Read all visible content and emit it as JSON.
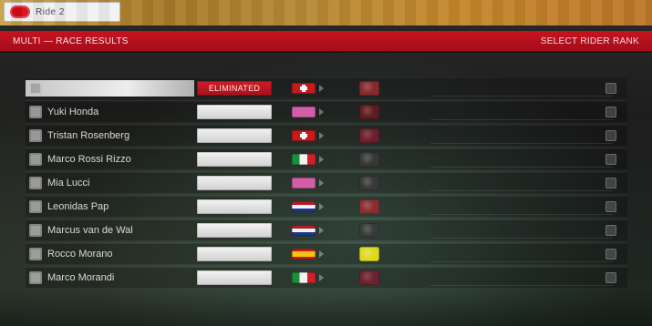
{
  "header": {
    "brand_text": "Ride 2",
    "title_left": "MULTI — RACE RESULTS",
    "title_right": "SELECT RIDER RANK"
  },
  "table": {
    "rows": [
      {
        "name": "",
        "status": "ELIMINATED",
        "flag": "ch",
        "bike_variant": "v2",
        "team": "",
        "selected": true
      },
      {
        "name": "Yuki Honda",
        "status": "",
        "flag": "generic",
        "bike_variant": "v1",
        "team": "",
        "selected": false
      },
      {
        "name": "Tristan Rosenberg",
        "status": "",
        "flag": "ch",
        "bike_variant": "v5",
        "team": "",
        "selected": false
      },
      {
        "name": "Marco Rossi Rizzo",
        "status": "",
        "flag": "it",
        "bike_variant": "v3",
        "team": "",
        "selected": false
      },
      {
        "name": "Mia Lucci",
        "status": "",
        "flag": "generic",
        "bike_variant": "v3",
        "team": "",
        "selected": false
      },
      {
        "name": "Leonidas Pap",
        "status": "",
        "flag": "nl",
        "bike_variant": "v2",
        "team": "",
        "selected": false
      },
      {
        "name": "Marcus van de Wal",
        "status": "",
        "flag": "nl",
        "bike_variant": "v3",
        "team": "",
        "selected": false
      },
      {
        "name": "Rocco Morano",
        "status": "",
        "flag": "es",
        "bike_variant": "v4",
        "team": "",
        "selected": false
      },
      {
        "name": "Marco Morandi",
        "status": "",
        "flag": "it",
        "bike_variant": "v5",
        "team": "",
        "selected": false
      }
    ]
  },
  "colors": {
    "accent_red": "#c81320",
    "header_gold": "#b48a3a"
  }
}
